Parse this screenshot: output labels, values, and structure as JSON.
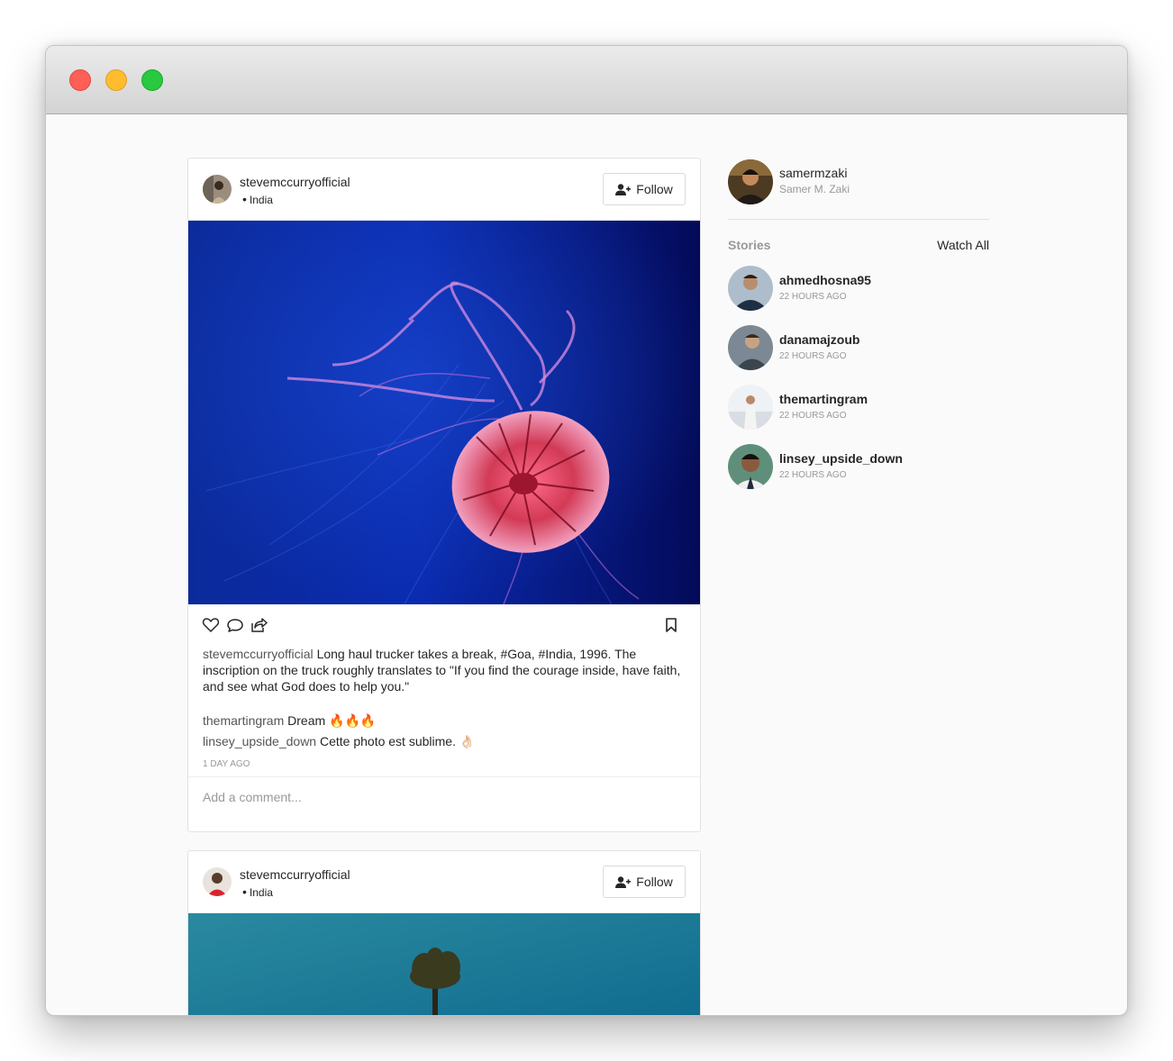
{
  "window": {
    "controls": [
      "close",
      "minimize",
      "zoom"
    ]
  },
  "posts": [
    {
      "username": "stevemccurryofficial",
      "location": "India",
      "follow_label": "Follow",
      "caption_user": "stevemccurryofficial",
      "caption_text": "Long haul trucker takes a break, #Goa, #India, 1996. The inscription on the truck roughly translates to \"If you find the courage inside, have faith, and see what God does to help you.\"",
      "comments": [
        {
          "user": "themartingram",
          "text": "Dream 🔥🔥🔥"
        },
        {
          "user": "linsey_upside_down",
          "text": "Cette photo est sublime. 👌🏻"
        }
      ],
      "timestamp": "1 DAY AGO",
      "add_comment_placeholder": "Add a comment..."
    },
    {
      "username": "stevemccurryofficial",
      "location": "India",
      "follow_label": "Follow"
    }
  ],
  "sidebar": {
    "me": {
      "username": "samermzaki",
      "full_name": "Samer M. Zaki"
    },
    "stories_title": "Stories",
    "watch_all": "Watch All",
    "stories": [
      {
        "username": "ahmedhosna95",
        "time": "22 HOURS AGO"
      },
      {
        "username": "danamajzoub",
        "time": "22 HOURS AGO"
      },
      {
        "username": "themartingram",
        "time": "22 HOURS AGO"
      },
      {
        "username": "linsey_upside_down",
        "time": "22 HOURS AGO"
      }
    ]
  },
  "icons": [
    "heart-icon",
    "comment-icon",
    "share-icon",
    "bookmark-icon",
    "user-plus-icon"
  ]
}
